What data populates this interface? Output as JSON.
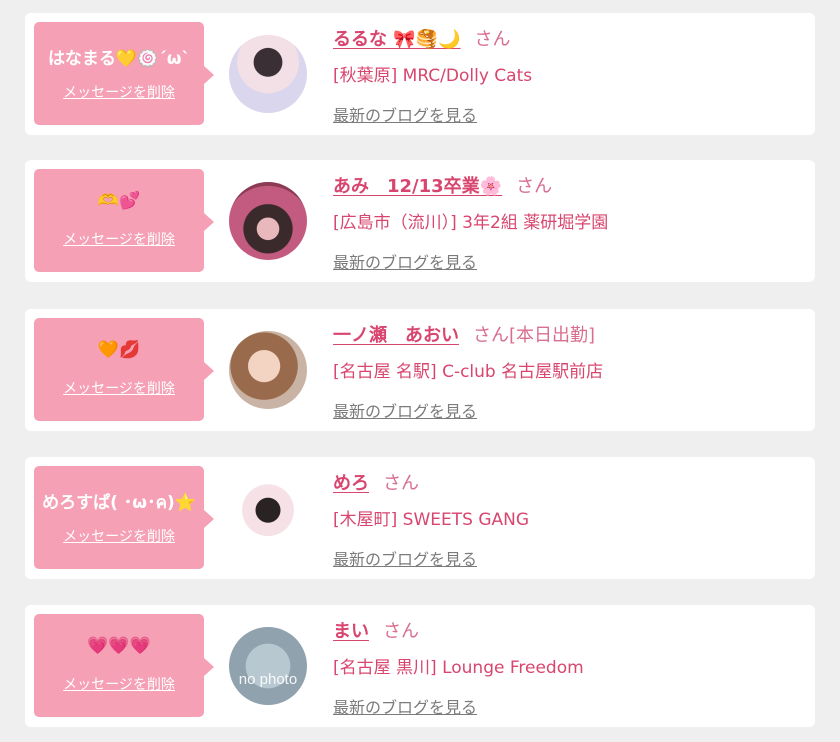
{
  "list": {
    "items": [
      {
        "message": "はなまる💛🍥´ω`",
        "delete_label": "メッセージを削除",
        "name": "るるな 🎀🥞🌙",
        "honorific": "さん",
        "extra": "",
        "shop": "[秋葉原] MRC/Dolly Cats",
        "blog_label": "最新のブログを見る",
        "avatar_text": ""
      },
      {
        "message": "🫶💕",
        "delete_label": "メッセージを削除",
        "name": "あみ　12/13卒業🌸",
        "honorific": "さん",
        "extra": "",
        "shop": "[広島市（流川）] 3年2組 薬研堀学園",
        "blog_label": "最新のブログを見る",
        "avatar_text": ""
      },
      {
        "message": "🧡💋",
        "delete_label": "メッセージを削除",
        "name": "一ノ瀬　あおい",
        "honorific": "さん",
        "extra": "[本日出勤]",
        "shop": "[名古屋 名駅] C-club 名古屋駅前店",
        "blog_label": "最新のブログを見る",
        "avatar_text": ""
      },
      {
        "message": "めろすぱ( ･ω･ค)⭐",
        "delete_label": "メッセージを削除",
        "name": "めろ",
        "honorific": "さん",
        "extra": "",
        "shop": "[木屋町] SWEETS GANG",
        "blog_label": "最新のブログを見る",
        "avatar_text": ""
      },
      {
        "message": "💗💗💗",
        "delete_label": "メッセージを削除",
        "name": "まい",
        "honorific": "さん",
        "extra": "",
        "shop": "[名古屋 黒川] Lounge Freedom",
        "blog_label": "最新のブログを見る",
        "avatar_text": "no photo"
      }
    ]
  }
}
